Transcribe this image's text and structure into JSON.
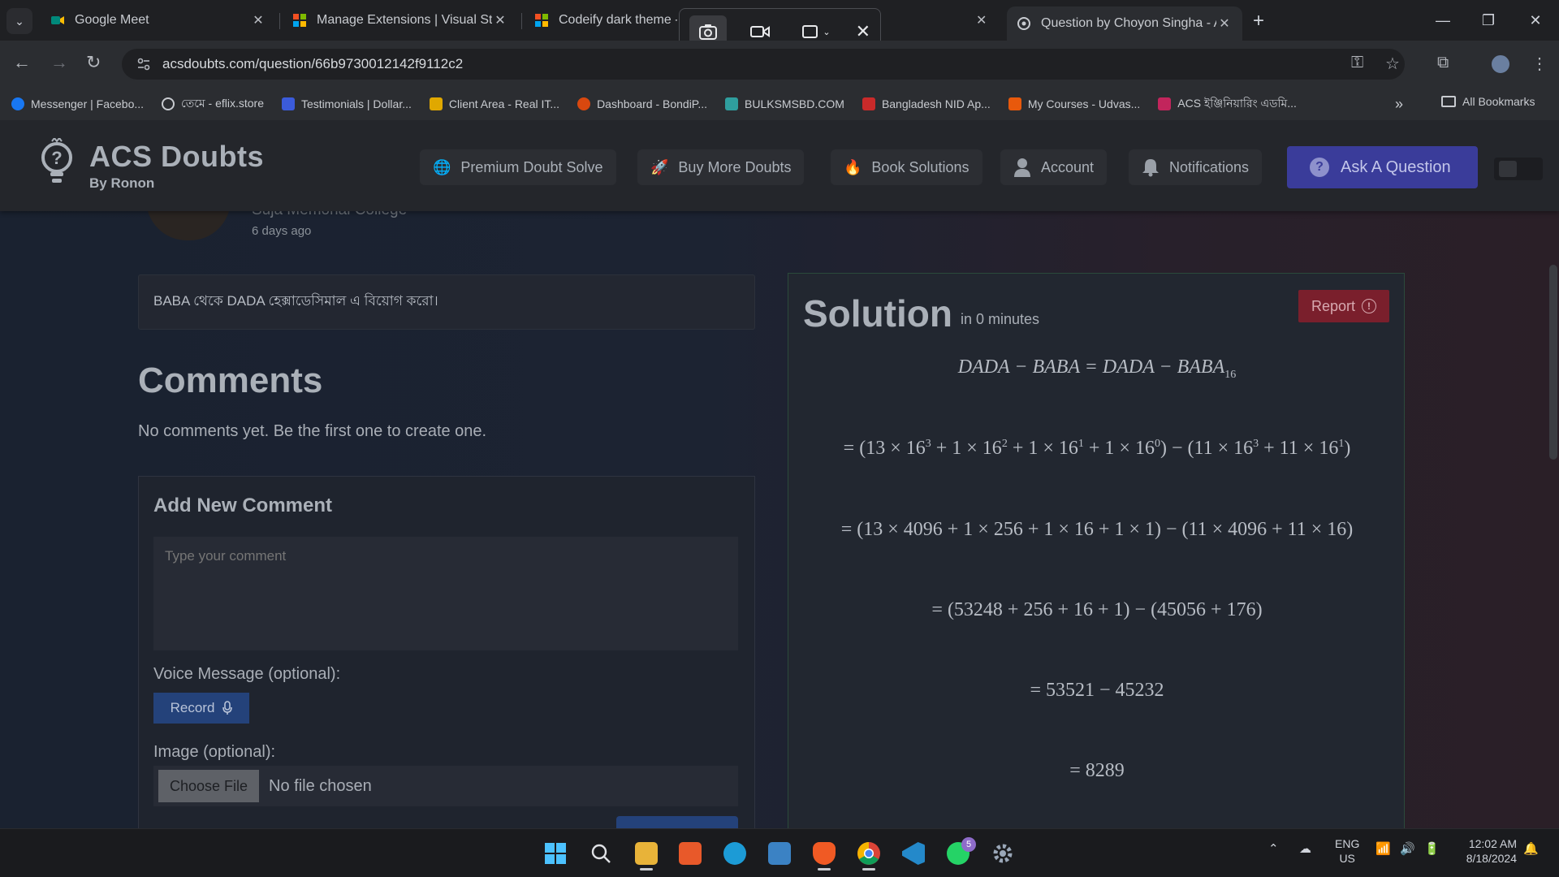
{
  "browser": {
    "tabs": [
      {
        "title": "Google Meet",
        "icon": "google-meet-icon"
      },
      {
        "title": "Manage Extensions | Visual Stu",
        "icon": "microsoft-icon"
      },
      {
        "title": "Codeify dark theme - V",
        "icon": "microsoft-icon"
      },
      {
        "title": "Question by Choyon Singha - A",
        "icon": "acs-favicon",
        "active": true
      }
    ],
    "url": "acsdoubts.com/question/66b9730012142f9112c2",
    "bookmarks": [
      "Messenger | Facebo...",
      "তেমে - eflix.store",
      "Testimonials | Dollar...",
      "Client Area - Real IT...",
      "Dashboard - BondiP...",
      "BULKSMSBD.COM",
      "Bangladesh NID Ap...",
      "My Courses - Udvas...",
      "ACS ইঞ্জিনিয়ারিং এডমি..."
    ],
    "all_bookmarks": "All Bookmarks"
  },
  "site": {
    "brand_name": "ACS Doubts",
    "brand_by": "By Ronon",
    "nav": [
      {
        "label": "Premium Doubt Solve",
        "icon": "globe-icon"
      },
      {
        "label": "Buy More Doubts",
        "icon": "rocket-icon"
      },
      {
        "label": "Book Solutions",
        "icon": "fire-icon"
      },
      {
        "label": "Account",
        "icon": "user-icon"
      },
      {
        "label": "Notifications",
        "icon": "bell-icon"
      }
    ],
    "ask_label": "Ask A Question"
  },
  "question": {
    "author_college": "Suja Memorial College",
    "time_ago": "6 days ago",
    "text": "BABA থেকে DADA হেক্সাডেসিমাল এ বিয়োগ করো।"
  },
  "comments": {
    "title": "Comments",
    "empty_text": "No comments yet. Be the first one to create one.",
    "form_title": "Add New Comment",
    "comment_placeholder": "Type your comment",
    "voice_label": "Voice Message (optional):",
    "record_label": "Record",
    "image_label": "Image (optional):",
    "choose_file_label": "Choose File",
    "no_file_text": "No file chosen"
  },
  "solution": {
    "title": "Solution",
    "time": "in 0 minutes",
    "report_label": "Report",
    "steps": [
      "DADA − BABA = DADA − BABA<sub>16</sub>",
      "= (13 × 16<sup>3</sup> + 1 × 16<sup>2</sup> + 1 × 16<sup>1</sup> + 1 × 16<sup>0</sup>) − (11 × 16<sup>3</sup> + 11 × 16<sup>1</sup>)",
      "= (13 × 4096 + 1 × 256 + 1 × 16 + 1 × 1) − (11 × 4096 + 11 × 16)",
      "= (53248 + 256 + 16 + 1) − (45056 + 176)",
      "= 53521 − 45232",
      "= 8289"
    ]
  },
  "taskbar": {
    "lang_1": "ENG",
    "lang_2": "US",
    "time": "12:02 AM",
    "date": "8/18/2024",
    "whatsapp_badge": "5"
  }
}
